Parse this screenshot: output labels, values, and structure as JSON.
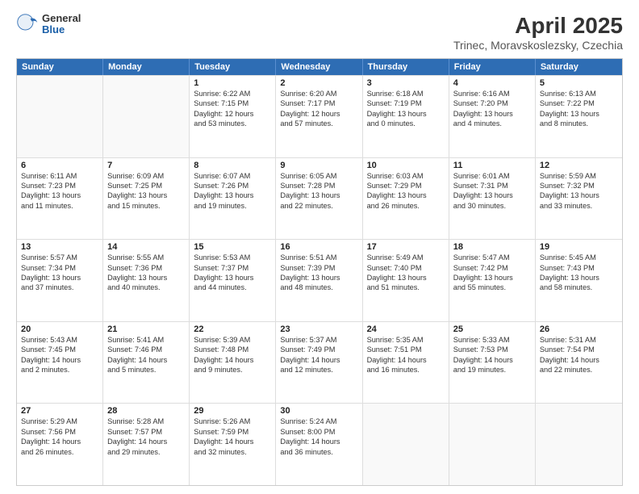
{
  "header": {
    "logo_general": "General",
    "logo_blue": "Blue",
    "main_title": "April 2025",
    "subtitle": "Trinec, Moravskoslezsky, Czechia"
  },
  "days_of_week": [
    "Sunday",
    "Monday",
    "Tuesday",
    "Wednesday",
    "Thursday",
    "Friday",
    "Saturday"
  ],
  "rows": [
    [
      {
        "day": "",
        "lines": []
      },
      {
        "day": "",
        "lines": []
      },
      {
        "day": "1",
        "lines": [
          "Sunrise: 6:22 AM",
          "Sunset: 7:15 PM",
          "Daylight: 12 hours",
          "and 53 minutes."
        ]
      },
      {
        "day": "2",
        "lines": [
          "Sunrise: 6:20 AM",
          "Sunset: 7:17 PM",
          "Daylight: 12 hours",
          "and 57 minutes."
        ]
      },
      {
        "day": "3",
        "lines": [
          "Sunrise: 6:18 AM",
          "Sunset: 7:19 PM",
          "Daylight: 13 hours",
          "and 0 minutes."
        ]
      },
      {
        "day": "4",
        "lines": [
          "Sunrise: 6:16 AM",
          "Sunset: 7:20 PM",
          "Daylight: 13 hours",
          "and 4 minutes."
        ]
      },
      {
        "day": "5",
        "lines": [
          "Sunrise: 6:13 AM",
          "Sunset: 7:22 PM",
          "Daylight: 13 hours",
          "and 8 minutes."
        ]
      }
    ],
    [
      {
        "day": "6",
        "lines": [
          "Sunrise: 6:11 AM",
          "Sunset: 7:23 PM",
          "Daylight: 13 hours",
          "and 11 minutes."
        ]
      },
      {
        "day": "7",
        "lines": [
          "Sunrise: 6:09 AM",
          "Sunset: 7:25 PM",
          "Daylight: 13 hours",
          "and 15 minutes."
        ]
      },
      {
        "day": "8",
        "lines": [
          "Sunrise: 6:07 AM",
          "Sunset: 7:26 PM",
          "Daylight: 13 hours",
          "and 19 minutes."
        ]
      },
      {
        "day": "9",
        "lines": [
          "Sunrise: 6:05 AM",
          "Sunset: 7:28 PM",
          "Daylight: 13 hours",
          "and 22 minutes."
        ]
      },
      {
        "day": "10",
        "lines": [
          "Sunrise: 6:03 AM",
          "Sunset: 7:29 PM",
          "Daylight: 13 hours",
          "and 26 minutes."
        ]
      },
      {
        "day": "11",
        "lines": [
          "Sunrise: 6:01 AM",
          "Sunset: 7:31 PM",
          "Daylight: 13 hours",
          "and 30 minutes."
        ]
      },
      {
        "day": "12",
        "lines": [
          "Sunrise: 5:59 AM",
          "Sunset: 7:32 PM",
          "Daylight: 13 hours",
          "and 33 minutes."
        ]
      }
    ],
    [
      {
        "day": "13",
        "lines": [
          "Sunrise: 5:57 AM",
          "Sunset: 7:34 PM",
          "Daylight: 13 hours",
          "and 37 minutes."
        ]
      },
      {
        "day": "14",
        "lines": [
          "Sunrise: 5:55 AM",
          "Sunset: 7:36 PM",
          "Daylight: 13 hours",
          "and 40 minutes."
        ]
      },
      {
        "day": "15",
        "lines": [
          "Sunrise: 5:53 AM",
          "Sunset: 7:37 PM",
          "Daylight: 13 hours",
          "and 44 minutes."
        ]
      },
      {
        "day": "16",
        "lines": [
          "Sunrise: 5:51 AM",
          "Sunset: 7:39 PM",
          "Daylight: 13 hours",
          "and 48 minutes."
        ]
      },
      {
        "day": "17",
        "lines": [
          "Sunrise: 5:49 AM",
          "Sunset: 7:40 PM",
          "Daylight: 13 hours",
          "and 51 minutes."
        ]
      },
      {
        "day": "18",
        "lines": [
          "Sunrise: 5:47 AM",
          "Sunset: 7:42 PM",
          "Daylight: 13 hours",
          "and 55 minutes."
        ]
      },
      {
        "day": "19",
        "lines": [
          "Sunrise: 5:45 AM",
          "Sunset: 7:43 PM",
          "Daylight: 13 hours",
          "and 58 minutes."
        ]
      }
    ],
    [
      {
        "day": "20",
        "lines": [
          "Sunrise: 5:43 AM",
          "Sunset: 7:45 PM",
          "Daylight: 14 hours",
          "and 2 minutes."
        ]
      },
      {
        "day": "21",
        "lines": [
          "Sunrise: 5:41 AM",
          "Sunset: 7:46 PM",
          "Daylight: 14 hours",
          "and 5 minutes."
        ]
      },
      {
        "day": "22",
        "lines": [
          "Sunrise: 5:39 AM",
          "Sunset: 7:48 PM",
          "Daylight: 14 hours",
          "and 9 minutes."
        ]
      },
      {
        "day": "23",
        "lines": [
          "Sunrise: 5:37 AM",
          "Sunset: 7:49 PM",
          "Daylight: 14 hours",
          "and 12 minutes."
        ]
      },
      {
        "day": "24",
        "lines": [
          "Sunrise: 5:35 AM",
          "Sunset: 7:51 PM",
          "Daylight: 14 hours",
          "and 16 minutes."
        ]
      },
      {
        "day": "25",
        "lines": [
          "Sunrise: 5:33 AM",
          "Sunset: 7:53 PM",
          "Daylight: 14 hours",
          "and 19 minutes."
        ]
      },
      {
        "day": "26",
        "lines": [
          "Sunrise: 5:31 AM",
          "Sunset: 7:54 PM",
          "Daylight: 14 hours",
          "and 22 minutes."
        ]
      }
    ],
    [
      {
        "day": "27",
        "lines": [
          "Sunrise: 5:29 AM",
          "Sunset: 7:56 PM",
          "Daylight: 14 hours",
          "and 26 minutes."
        ]
      },
      {
        "day": "28",
        "lines": [
          "Sunrise: 5:28 AM",
          "Sunset: 7:57 PM",
          "Daylight: 14 hours",
          "and 29 minutes."
        ]
      },
      {
        "day": "29",
        "lines": [
          "Sunrise: 5:26 AM",
          "Sunset: 7:59 PM",
          "Daylight: 14 hours",
          "and 32 minutes."
        ]
      },
      {
        "day": "30",
        "lines": [
          "Sunrise: 5:24 AM",
          "Sunset: 8:00 PM",
          "Daylight: 14 hours",
          "and 36 minutes."
        ]
      },
      {
        "day": "",
        "lines": []
      },
      {
        "day": "",
        "lines": []
      },
      {
        "day": "",
        "lines": []
      }
    ]
  ]
}
